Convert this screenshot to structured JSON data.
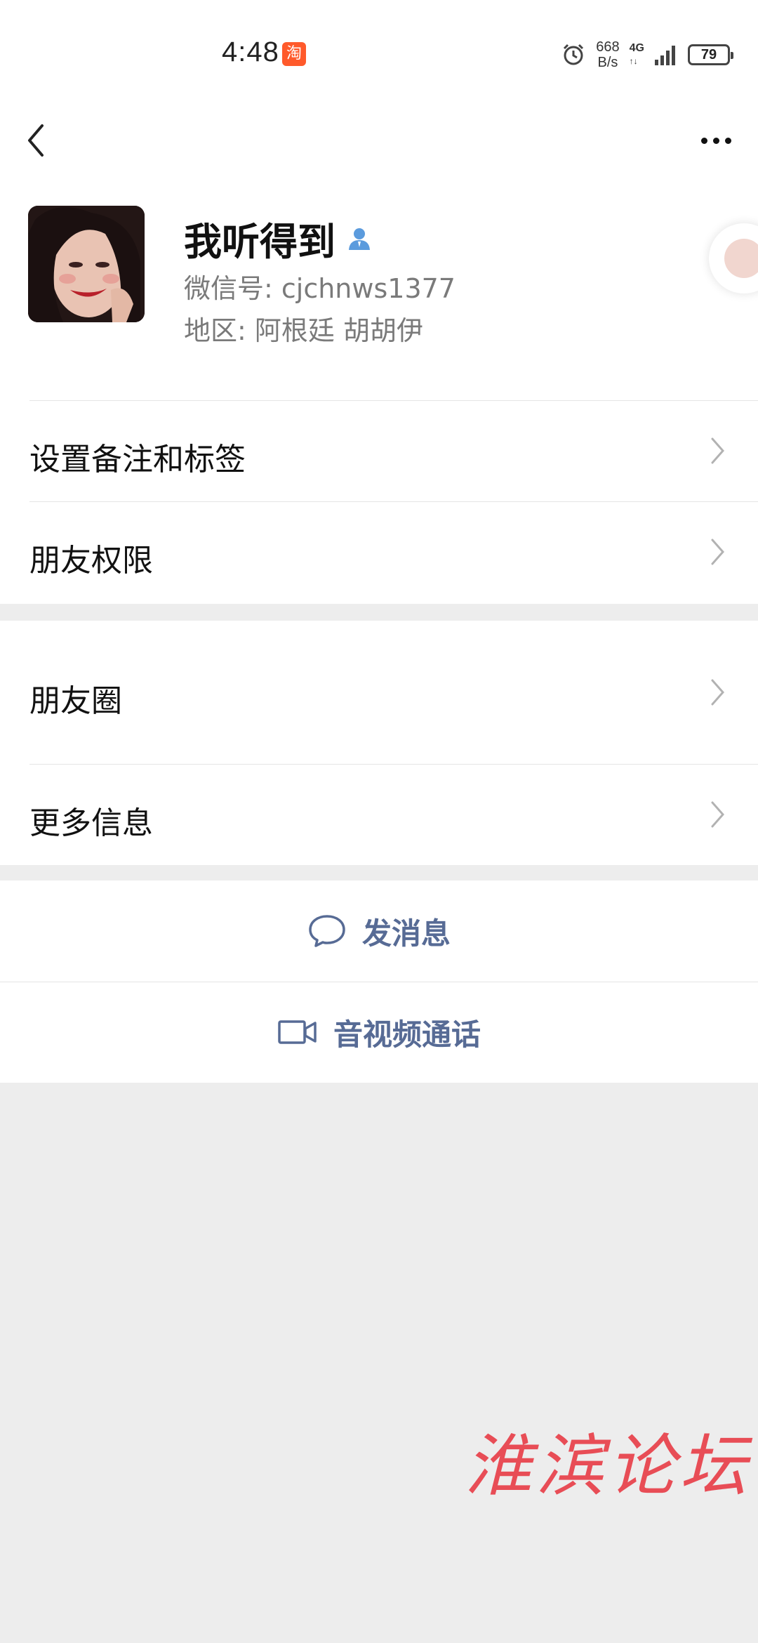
{
  "status_bar": {
    "time": "4:48",
    "app_icon_glyph": "淘",
    "net_speed_value": "668",
    "net_speed_unit": "B/s",
    "network_type": "4G",
    "battery": "79"
  },
  "profile": {
    "name": "我听得到",
    "wechat_id": "微信号: cjchnws1377",
    "region": "地区: 阿根廷 胡胡伊"
  },
  "menu": {
    "remark_tags": "设置备注和标签",
    "friend_permissions": "朋友权限",
    "moments": "朋友圈",
    "more_info": "更多信息"
  },
  "actions": {
    "send_message": "发消息",
    "av_call": "音视频通话"
  },
  "watermark": "淮滨论坛",
  "colors": {
    "link_blue": "#576b95",
    "background_gray": "#ededed",
    "watermark_red": "#e8323c"
  }
}
